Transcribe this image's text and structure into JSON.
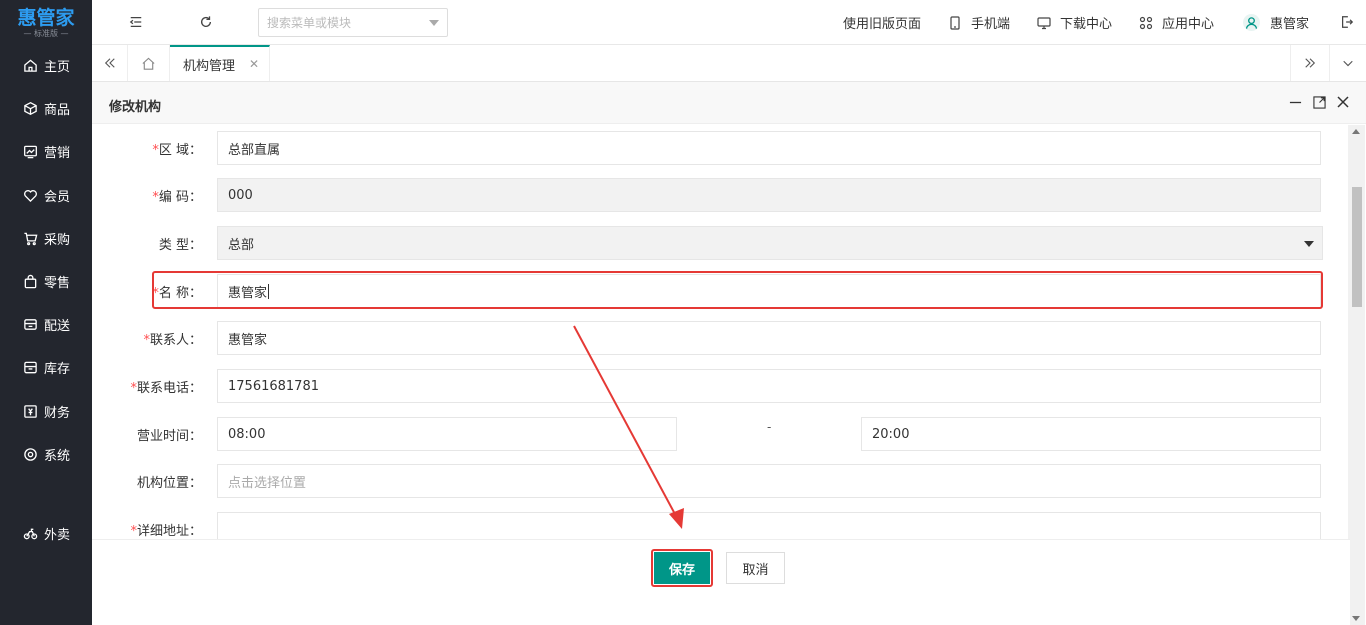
{
  "brand": {
    "name": "惠管家",
    "edition": "— 标准版 —"
  },
  "sidebar": {
    "items": [
      {
        "label": "主页",
        "icon": "home-icon"
      },
      {
        "label": "商品",
        "icon": "cube-icon"
      },
      {
        "label": "营销",
        "icon": "chart-icon"
      },
      {
        "label": "会员",
        "icon": "heart-icon"
      },
      {
        "label": "采购",
        "icon": "cart-icon"
      },
      {
        "label": "零售",
        "icon": "bag-icon"
      },
      {
        "label": "配送",
        "icon": "truck-icon"
      },
      {
        "label": "库存",
        "icon": "box-icon"
      },
      {
        "label": "财务",
        "icon": "finance-icon"
      },
      {
        "label": "系统",
        "icon": "settings-icon"
      },
      {
        "label": "外卖",
        "icon": "bike-icon"
      }
    ]
  },
  "header": {
    "search_placeholder": "搜索菜单或模块",
    "links": {
      "old_version": "使用旧版页面",
      "mobile": "手机端",
      "download": "下载中心",
      "apps": "应用中心",
      "user": "惠管家"
    }
  },
  "tabs": {
    "active": "机构管理"
  },
  "dialog": {
    "title": "修改机构",
    "fields": {
      "region": {
        "label": "区 域：",
        "value": "总部直属"
      },
      "code": {
        "label": "编 码：",
        "value": "000"
      },
      "type": {
        "label": "类 型：",
        "value": "总部"
      },
      "name": {
        "label": "名 称：",
        "value": "惠管家"
      },
      "contact": {
        "label": "联系人：",
        "value": "惠管家"
      },
      "phone": {
        "label": "联系电话：",
        "value": "17561681781"
      },
      "hours": {
        "label": "营业时间：",
        "start": "08:00",
        "separator": "-",
        "end": "20:00"
      },
      "location": {
        "label": "机构位置：",
        "placeholder": "点击选择位置"
      },
      "address": {
        "label": "详细地址：",
        "value": ""
      }
    },
    "buttons": {
      "save": "保存",
      "cancel": "取消"
    }
  },
  "colors": {
    "accent": "#009688",
    "sidebar_bg": "#23262e",
    "highlight": "#e53935",
    "required": "#ff4d4f"
  }
}
